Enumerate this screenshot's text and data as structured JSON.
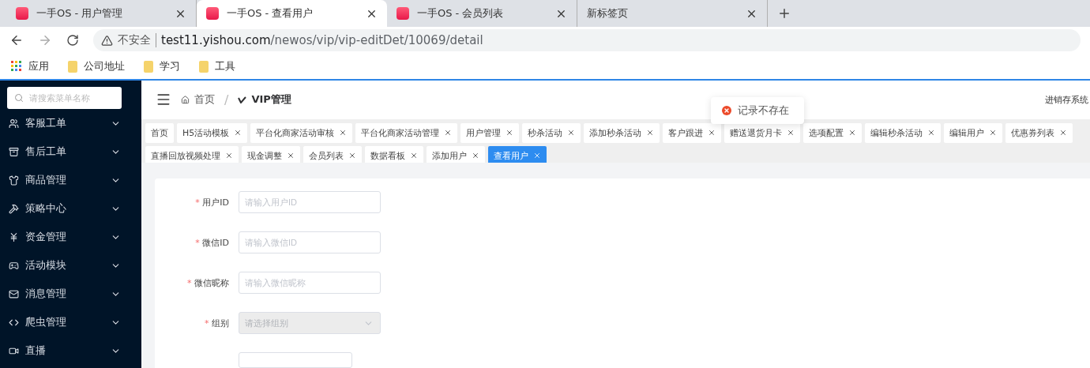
{
  "browser": {
    "tabs": [
      {
        "title": "一手OS - 用户管理",
        "selected": false,
        "favicon": true
      },
      {
        "title": "一手OS - 查看用户",
        "selected": true,
        "favicon": true
      },
      {
        "title": "一手OS - 会员列表",
        "selected": false,
        "favicon": true
      },
      {
        "title": "新标签页",
        "selected": false,
        "favicon": false
      }
    ],
    "security": "不安全",
    "url_host": "test11.yishou.com",
    "url_path": "/newos/vip/vip-editDet/10069/detail",
    "bookmarks": [
      {
        "label": "应用",
        "kind": "apps"
      },
      {
        "label": "公司地址",
        "kind": "folder"
      },
      {
        "label": "学习",
        "kind": "folder"
      },
      {
        "label": "工具",
        "kind": "folder"
      }
    ]
  },
  "sidebar": {
    "search_placeholder": "请搜索菜单名称",
    "items": [
      {
        "label": "客服工单"
      },
      {
        "label": "售后工单"
      },
      {
        "label": "商品管理"
      },
      {
        "label": "策略中心"
      },
      {
        "label": "资金管理"
      },
      {
        "label": "活动模块"
      },
      {
        "label": "消息管理"
      },
      {
        "label": "爬虫管理"
      },
      {
        "label": "直播"
      }
    ]
  },
  "breadcrumb": [
    "首页",
    "VIP管理"
  ],
  "breadcrumb_separator": "/",
  "header_right": "进销存系统",
  "toast": {
    "text": "记录不存在"
  },
  "page_tabs": [
    {
      "label": "首页",
      "closable": false,
      "selected": false
    },
    {
      "label": "H5活动模板",
      "closable": true,
      "selected": false
    },
    {
      "label": "平台化商家活动审核",
      "closable": true,
      "selected": false
    },
    {
      "label": "平台化商家活动管理",
      "closable": true,
      "selected": false
    },
    {
      "label": "用户管理",
      "closable": true,
      "selected": false
    },
    {
      "label": "秒杀活动",
      "closable": true,
      "selected": false
    },
    {
      "label": "添加秒杀活动",
      "closable": true,
      "selected": false
    },
    {
      "label": "客户跟进",
      "closable": true,
      "selected": false
    },
    {
      "label": "赠送退货月卡",
      "closable": true,
      "selected": false
    },
    {
      "label": "选项配置",
      "closable": true,
      "selected": false
    },
    {
      "label": "编辑秒杀活动",
      "closable": true,
      "selected": false
    },
    {
      "label": "编辑用户",
      "closable": true,
      "selected": false
    },
    {
      "label": "优惠券列表",
      "closable": true,
      "selected": false
    },
    {
      "label": "直播回放视频处理",
      "closable": true,
      "selected": false
    },
    {
      "label": "现金调整",
      "closable": true,
      "selected": false
    },
    {
      "label": "会员列表",
      "closable": true,
      "selected": false
    },
    {
      "label": "数据看板",
      "closable": true,
      "selected": false
    },
    {
      "label": "添加用户",
      "closable": true,
      "selected": false
    },
    {
      "label": "查看用户",
      "closable": true,
      "selected": true
    }
  ],
  "form": {
    "fields": [
      {
        "label": "用户ID",
        "placeholder": "请输入用户ID",
        "kind": "input",
        "required_mark": "*",
        "disabled": false
      },
      {
        "label": "微信ID",
        "placeholder": "请输入微信ID",
        "kind": "input",
        "required_mark": "*",
        "disabled": false
      },
      {
        "label": "微信昵称",
        "placeholder": "请输入微信昵称",
        "kind": "input",
        "required_mark": "*",
        "disabled": false
      },
      {
        "label": "组别",
        "placeholder": "请选择组别",
        "kind": "select",
        "required_mark": "*",
        "disabled": true
      }
    ]
  }
}
